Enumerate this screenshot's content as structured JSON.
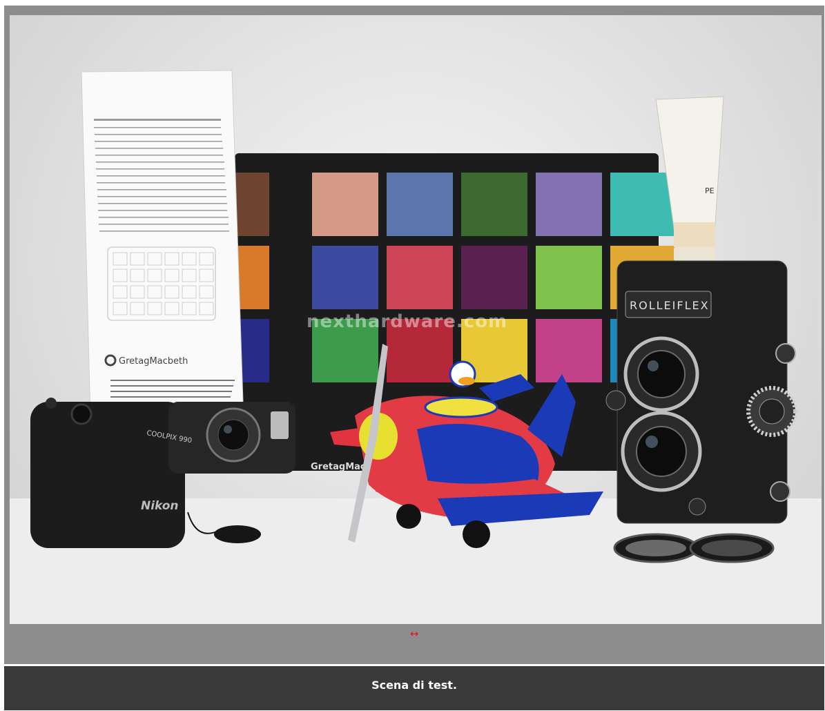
{
  "photo": {
    "alt": "Scena di test.",
    "watermark": "nexthardware.com",
    "checker_brand": "GretagMacbeth",
    "card_brand": "GretagMacbeth",
    "nikon_model": "COOLPIX 990",
    "nikon_brand": "Nikon",
    "rollei_brand": "ROLLEIFLEX",
    "tube_label": "PE",
    "swatch_colors": [
      [
        "#6e4330",
        "#d49a86",
        "#5a76aa",
        "#3c6a30",
        "#8272b2",
        "#3fbcb2"
      ],
      [
        "#d97a2a",
        "#3c4aa0",
        "#cf4558",
        "#5a2050",
        "#7ec24c",
        "#e2a834"
      ],
      [
        "#2a2a8a",
        "#3c9c4c",
        "#b4283a",
        "#e8c834",
        "#c2428a",
        "#1e8abc"
      ]
    ]
  },
  "viewer": {
    "toggle_icon": "↔"
  },
  "caption": {
    "text": "Scena di test."
  }
}
